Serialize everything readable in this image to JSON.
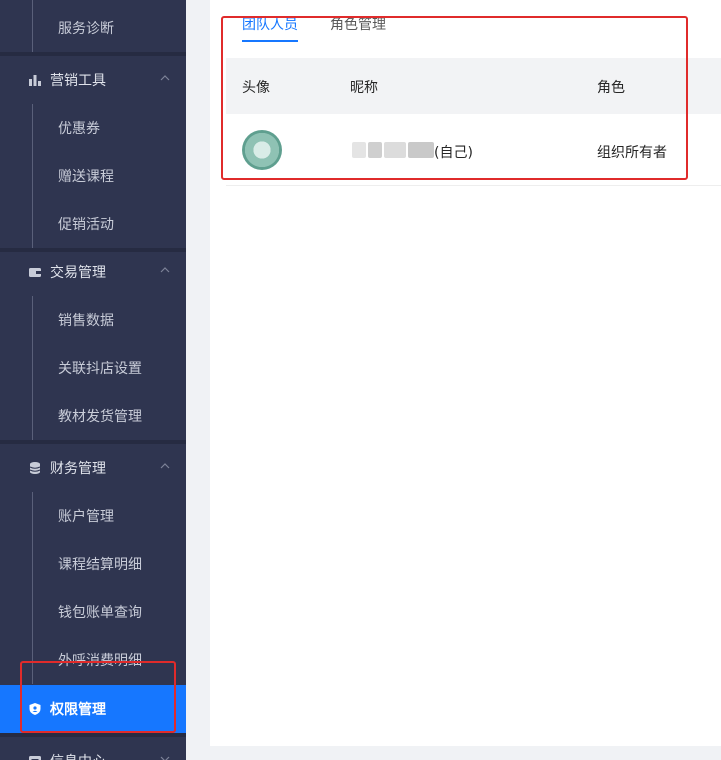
{
  "sidebar": {
    "top_items": [
      {
        "label": "服务诊断"
      }
    ],
    "groups": [
      {
        "title": "营销工具",
        "icon": "chart-icon",
        "items": [
          {
            "label": "优惠券"
          },
          {
            "label": "赠送课程"
          },
          {
            "label": "促销活动"
          }
        ]
      },
      {
        "title": "交易管理",
        "icon": "wallet-icon",
        "items": [
          {
            "label": "销售数据"
          },
          {
            "label": "关联抖店设置"
          },
          {
            "label": "教材发货管理"
          }
        ]
      },
      {
        "title": "财务管理",
        "icon": "database-icon",
        "items": [
          {
            "label": "账户管理"
          },
          {
            "label": "课程结算明细"
          },
          {
            "label": "钱包账单查询"
          },
          {
            "label": "外呼消费明细"
          }
        ]
      }
    ],
    "active": {
      "label": "权限管理",
      "icon": "shield-icon"
    },
    "bottom_group": {
      "title": "信息中心",
      "icon": "info-icon"
    }
  },
  "main": {
    "tabs": [
      {
        "label": "团队人员",
        "active": true
      },
      {
        "label": "角色管理",
        "active": false
      }
    ],
    "table": {
      "headers": [
        "头像",
        "昵称",
        "角色"
      ],
      "rows": [
        {
          "nickname_suffix": "(自己)",
          "role": "组织所有者"
        }
      ]
    }
  },
  "colors": {
    "sidebar_bg": "#2f3550",
    "accent": "#1677ff",
    "highlight": "#e02b2b"
  }
}
